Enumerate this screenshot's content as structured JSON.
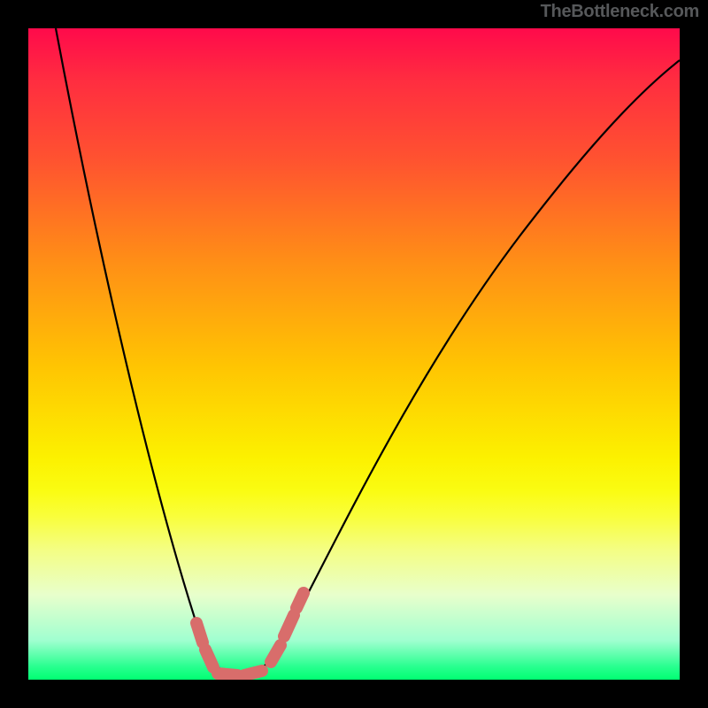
{
  "watermark": "TheBottleneck.com",
  "chart_data": {
    "type": "line",
    "title": "",
    "xlabel": "",
    "ylabel": "",
    "x_range_pct": [
      0,
      100
    ],
    "y_axis_semantics": "lower_is_better",
    "background_gradient_stops": [
      {
        "pos_pct": 0,
        "color": "#ff0a4b"
      },
      {
        "pos_pct": 8,
        "color": "#ff2d40"
      },
      {
        "pos_pct": 20,
        "color": "#ff5230"
      },
      {
        "pos_pct": 36,
        "color": "#ff8f16"
      },
      {
        "pos_pct": 52,
        "color": "#ffc502"
      },
      {
        "pos_pct": 66,
        "color": "#fcf100"
      },
      {
        "pos_pct": 71,
        "color": "#fafc12"
      },
      {
        "pos_pct": 75,
        "color": "#f9fe3c"
      },
      {
        "pos_pct": 80,
        "color": "#f4fe83"
      },
      {
        "pos_pct": 87,
        "color": "#e8ffcc"
      },
      {
        "pos_pct": 94,
        "color": "#a0ffd0"
      },
      {
        "pos_pct": 98,
        "color": "#28ff8f"
      },
      {
        "pos_pct": 100,
        "color": "#01ff72"
      }
    ],
    "series": [
      {
        "name": "bottleneck-curve",
        "stroke": "#000000",
        "points_pct": [
          {
            "x": 4.2,
            "y": 0
          },
          {
            "x": 12,
            "y": 40
          },
          {
            "x": 20,
            "y": 74
          },
          {
            "x": 26.4,
            "y": 93
          },
          {
            "x": 30,
            "y": 98.5
          },
          {
            "x": 32,
            "y": 99.3
          },
          {
            "x": 35,
            "y": 98.6
          },
          {
            "x": 39,
            "y": 94
          },
          {
            "x": 48,
            "y": 78
          },
          {
            "x": 60,
            "y": 55
          },
          {
            "x": 75,
            "y": 32
          },
          {
            "x": 88,
            "y": 14
          },
          {
            "x": 100,
            "y": 5
          }
        ],
        "marker_segments_pct": [
          [
            {
              "x": 25.8,
              "y": 91.3
            },
            {
              "x": 26.8,
              "y": 94.3
            }
          ],
          [
            {
              "x": 27.2,
              "y": 95.4
            },
            {
              "x": 28.4,
              "y": 98.1
            }
          ],
          [
            {
              "x": 29.1,
              "y": 99.0
            },
            {
              "x": 32.1,
              "y": 99.3
            }
          ],
          [
            {
              "x": 33.2,
              "y": 99.3
            },
            {
              "x": 35.9,
              "y": 98.6
            }
          ],
          [
            {
              "x": 37.2,
              "y": 97.3
            },
            {
              "x": 38.7,
              "y": 94.7
            }
          ],
          [
            {
              "x": 39.3,
              "y": 93.3
            },
            {
              "x": 40.8,
              "y": 90.1
            }
          ],
          [
            {
              "x": 41.2,
              "y": 89.0
            },
            {
              "x": 42.3,
              "y": 86.7
            }
          ]
        ],
        "marker_color": "#d86d6b"
      }
    ],
    "optimal_x_pct": 32,
    "notes": "V-shaped curve over a red→green vertical heat gradient. Trough (minimum, ≈ zero bottleneck) occurs near 32% of the x-axis. Pink dashed capsule markers highlight the trough region. No axis ticks, labels, or legend are rendered."
  }
}
